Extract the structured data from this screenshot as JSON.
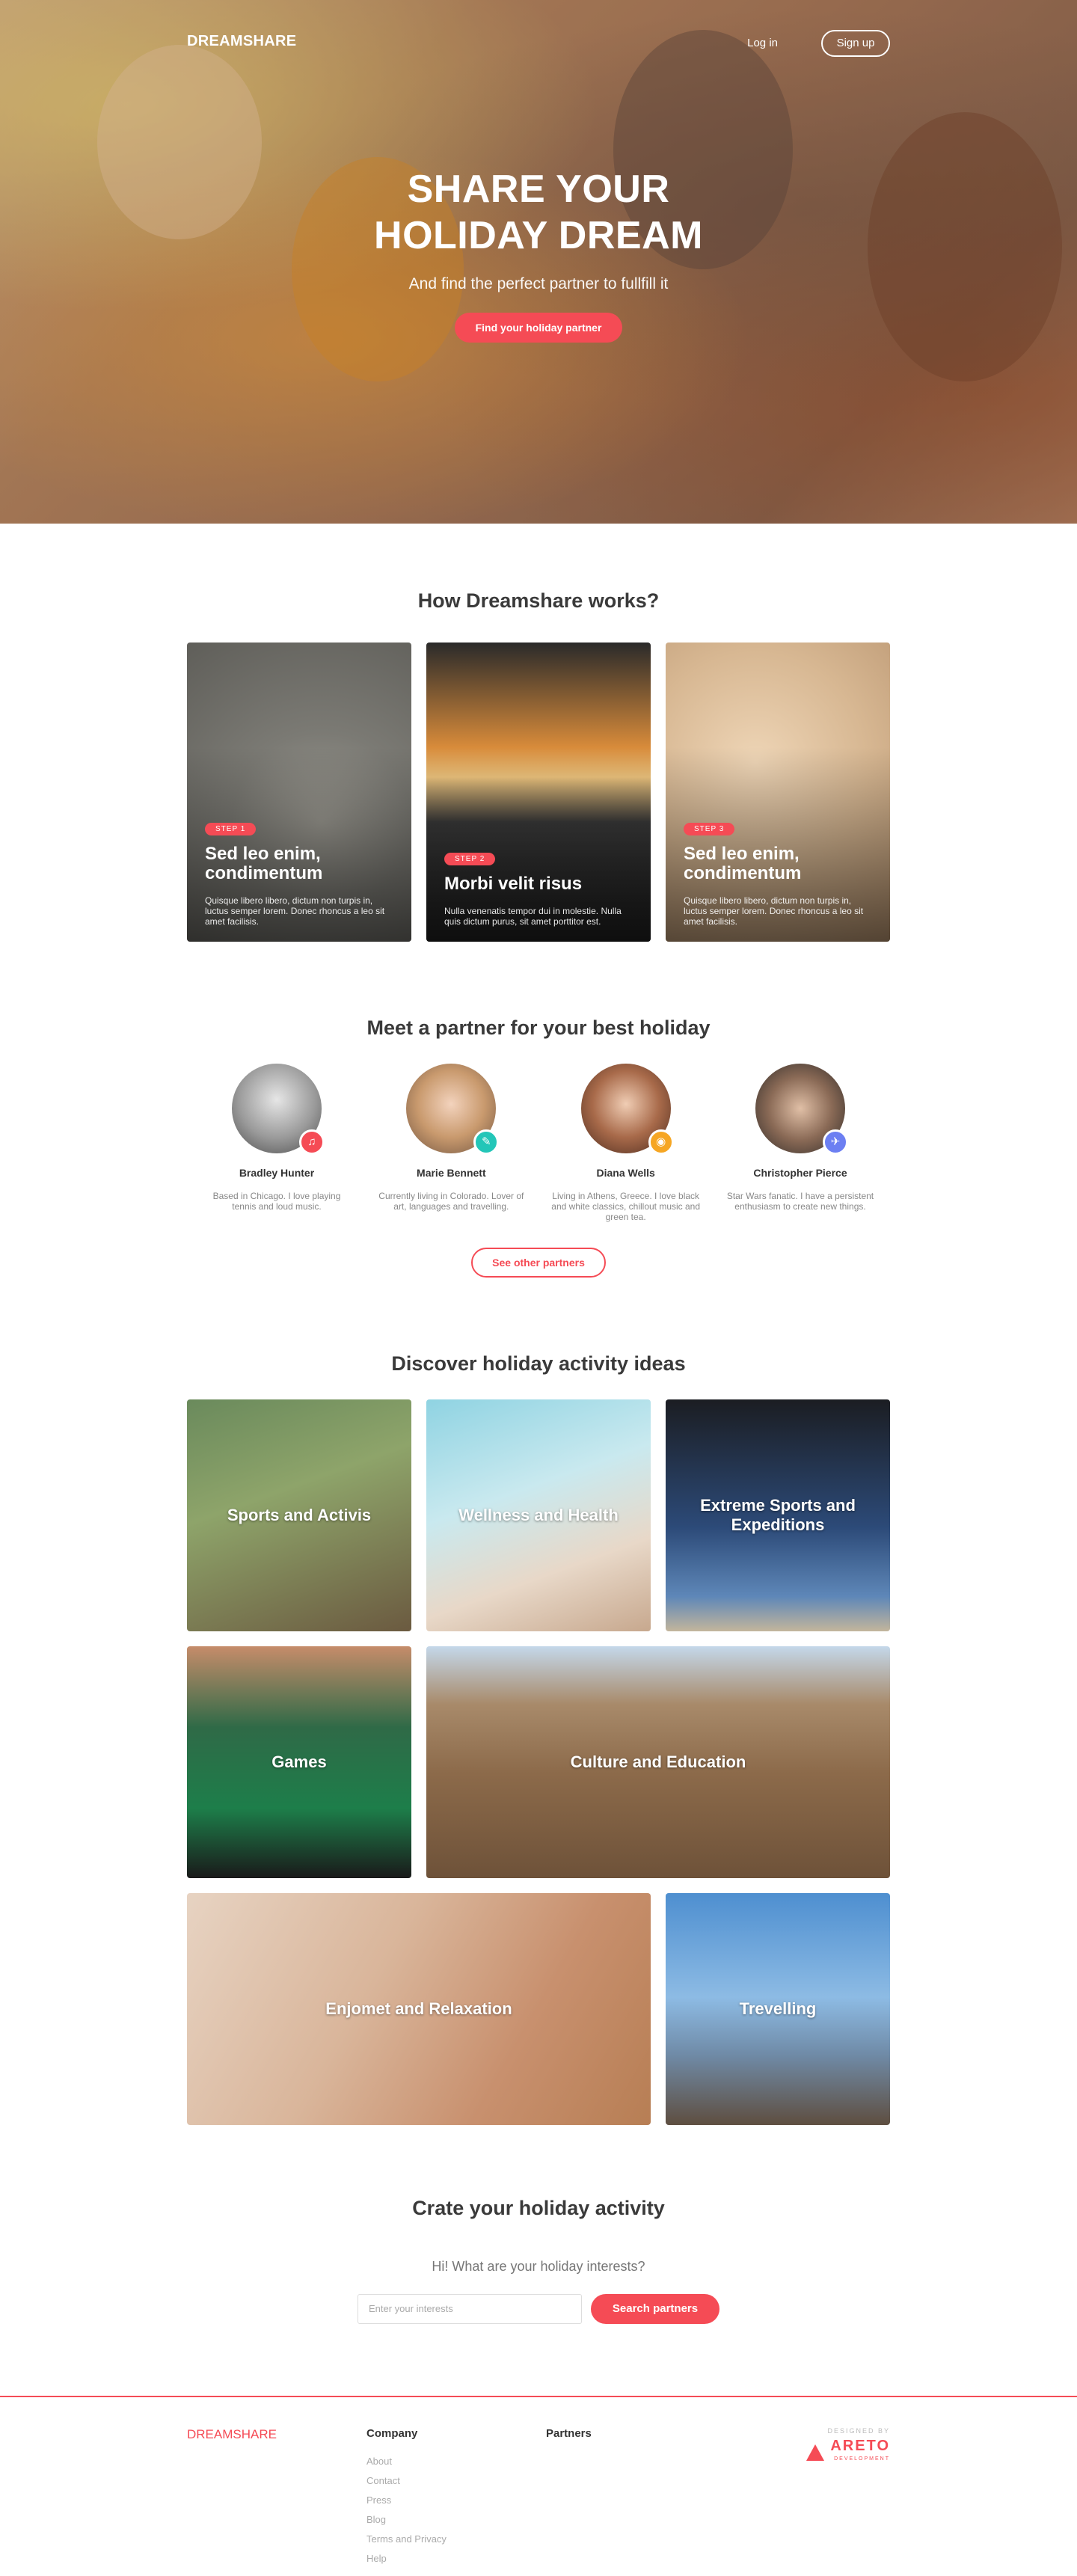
{
  "nav": {
    "logo": "DREAMSHARE",
    "login": "Log in",
    "signup": "Sign up"
  },
  "hero": {
    "title_line1": "SHARE YOUR",
    "title_line2": "HOLIDAY DREAM",
    "subtitle": "And find the perfect partner to fullfill it",
    "cta": "Find your holiday partner"
  },
  "how": {
    "title": "How Dreamshare works?",
    "steps": [
      {
        "badge": "STEP 1",
        "title": "Sed leo enim, condimentum",
        "text": "Quisque libero libero, dictum non turpis in, luctus semper lorem. Donec rhoncus a leo sit amet facilisis."
      },
      {
        "badge": "STEP 2",
        "title": "Morbi velit risus",
        "text": "Nulla venenatis tempor dui in molestie. Nulla quis dictum purus, sit amet porttitor est."
      },
      {
        "badge": "STEP 3",
        "title": "Sed leo enim, condimentum",
        "text": "Quisque libero libero, dictum non turpis in, luctus semper lorem. Donec rhoncus a leo sit amet facilisis."
      }
    ]
  },
  "partners": {
    "title": "Meet a partner for your best holiday",
    "people": [
      {
        "name": "Bradley Hunter",
        "desc": "Based in Chicago. I love playing tennis and loud music.",
        "icon": "music-icon",
        "glyph": "♫",
        "color": "#f54b55"
      },
      {
        "name": "Marie Bennett",
        "desc": "Currently living in Colorado. Lover of art, languages and travelling.",
        "icon": "pencil-icon",
        "glyph": "✎",
        "color": "#23c6b8"
      },
      {
        "name": "Diana Wells",
        "desc": "Living in Athens, Greece. I love black and white classics, chillout music and green tea.",
        "icon": "camera-icon",
        "glyph": "◉",
        "color": "#f6a623"
      },
      {
        "name": "Christopher Pierce",
        "desc": "Star Wars fanatic. I have a persistent enthusiasm to create new things.",
        "icon": "airplane-icon",
        "glyph": "✈",
        "color": "#6c7ff2"
      }
    ],
    "more": "See other partners"
  },
  "activities": {
    "title": "Discover holiday activity ideas",
    "tiles": [
      "Sports and Activis",
      "Wellness and Health",
      "Extreme Sports and Expeditions",
      "Games",
      "Culture and Education",
      "Enjomet and Relaxation",
      "Trevelling"
    ]
  },
  "create": {
    "title": "Crate your holiday activity",
    "prompt": "Hi! What are your holiday interests?",
    "placeholder": "Enter your interests",
    "button": "Search partners"
  },
  "footer": {
    "logo": "DREAMSHARE",
    "company_title": "Company",
    "company_links": [
      "About",
      "Contact",
      "Press",
      "Blog",
      "Terms and Privacy",
      "Help"
    ],
    "partners_title": "Partners",
    "designed_by": "DESIGNED BY",
    "brand": "ARETO",
    "brand_sub": "DEVELOPMENT"
  },
  "colors": {
    "accent": "#f54b55"
  }
}
